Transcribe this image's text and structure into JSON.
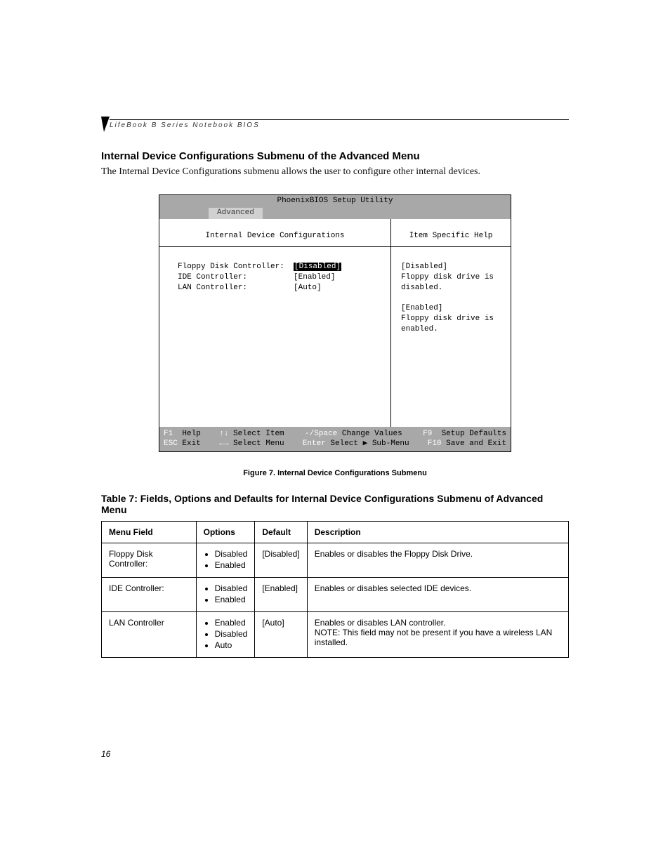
{
  "header": {
    "running": "LifeBook B Series Notebook BIOS"
  },
  "section": {
    "title": "Internal Device Configurations Submenu of the Advanced Menu",
    "intro": "The Internal Device Configurations submenu allows the user to configure other internal devices."
  },
  "bios": {
    "title": "PhoenixBIOS Setup Utility",
    "tab": "Advanced",
    "left_header": "Internal Device Configurations",
    "right_header": "Item Specific Help",
    "fields": [
      {
        "label": "Floppy Disk Controller:",
        "value": "[Disabled]",
        "selected": true
      },
      {
        "label": "IDE Controller:",
        "value": "[Enabled]",
        "selected": false
      },
      {
        "label": "LAN Controller:",
        "value": "[Auto]",
        "selected": false
      }
    ],
    "help": [
      "[Disabled]",
      "Floppy disk drive is",
      "disabled.",
      "",
      "[Enabled]",
      "Floppy disk drive is",
      "enabled."
    ],
    "footer": {
      "f1": "F1",
      "f1_label": "Help",
      "esc": "ESC",
      "esc_label": "Exit",
      "sel_item_arrows": "↑↓",
      "sel_item_label": "Select Item",
      "sel_menu_arrows": "←→",
      "sel_menu_label": "Select Menu",
      "chg_key": "-/Space",
      "chg_label": "Change Values",
      "enter_key": "Enter",
      "enter_label": "Select ▶ Sub-Menu",
      "f9": "F9",
      "f9_label": "Setup Defaults",
      "f10": "F10",
      "f10_label": "Save and Exit"
    }
  },
  "figure_caption": "Figure 7.  Internal Device Configurations Submenu",
  "table": {
    "title": "Table 7: Fields, Options and Defaults for Internal Device Configurations Submenu of Advanced Menu",
    "headers": [
      "Menu Field",
      "Options",
      "Default",
      "Description"
    ],
    "rows": [
      {
        "field": "Floppy Disk Controller:",
        "options": [
          "Disabled",
          "Enabled"
        ],
        "default": "[Disabled]",
        "description": "Enables or disables the Floppy Disk Drive."
      },
      {
        "field": "IDE Controller:",
        "options": [
          "Disabled",
          "Enabled"
        ],
        "default": "[Enabled]",
        "description": "Enables or disables selected IDE devices."
      },
      {
        "field": "LAN Controller",
        "options": [
          "Enabled",
          "Disabled",
          "Auto"
        ],
        "default": "[Auto]",
        "description": "Enables or disables LAN controller.\nNOTE: This field may not be present if you have a wireless LAN installed."
      }
    ]
  },
  "page_number": "16"
}
